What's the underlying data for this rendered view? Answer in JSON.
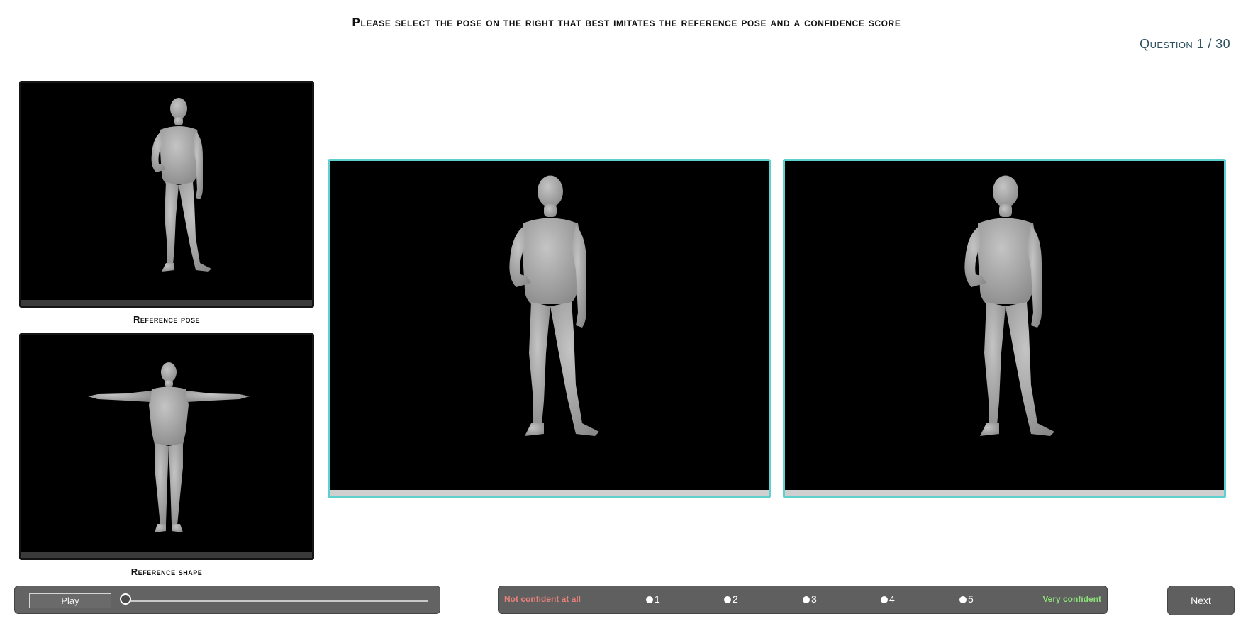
{
  "header": {
    "instruction": "Please select the pose on the right that best imitates the reference pose and a confidence score",
    "counter": "Question 1 / 30"
  },
  "references": {
    "pose_label": "Reference pose",
    "shape_label": "Reference shape"
  },
  "player": {
    "play_label": "Play",
    "progress": 0
  },
  "confidence": {
    "low_label": "Not confident at all",
    "high_label": "Very confident",
    "options": [
      "1",
      "2",
      "3",
      "4",
      "5"
    ],
    "low_color": "#e8807a",
    "high_color": "#8ce07a"
  },
  "navigation": {
    "next_label": "Next"
  },
  "colors": {
    "selection_border": "#5dd0cf",
    "panel_bg": "#000000",
    "figure": "#a9a9a9"
  }
}
